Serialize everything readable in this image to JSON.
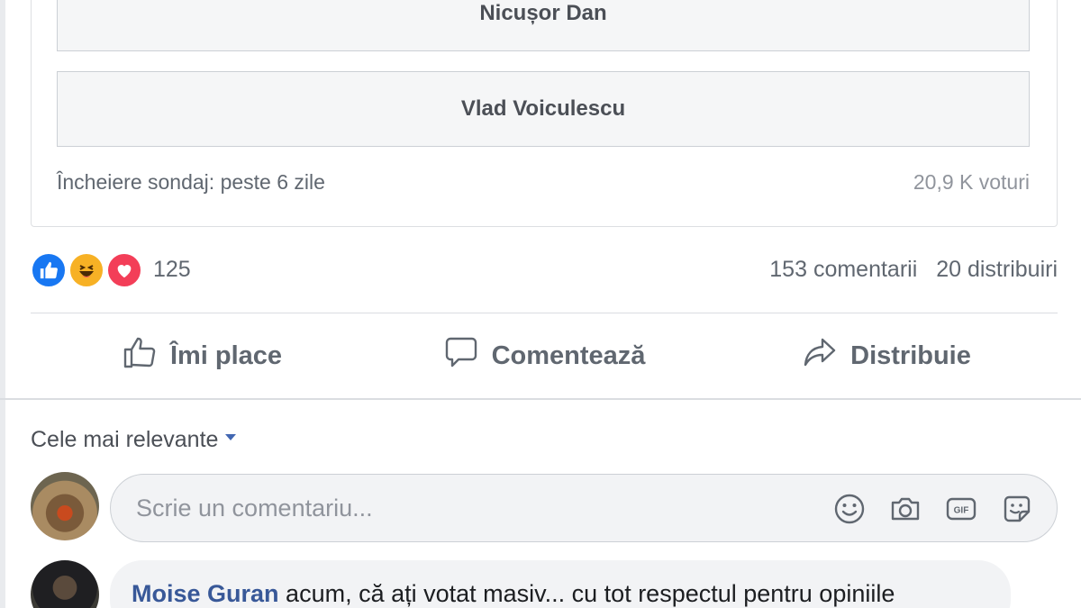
{
  "poll": {
    "options": [
      {
        "label": "Nicușor Dan"
      },
      {
        "label": "Vlad Voiculescu"
      }
    ],
    "closing_text": "Încheiere sondaj: peste 6 zile",
    "votes_text": "20,9 K voturi"
  },
  "reactions": {
    "icons": [
      "like-icon",
      "haha-icon",
      "love-icon"
    ],
    "count": "125",
    "comments_count": "153 comentarii",
    "shares_count": "20 distribuiri"
  },
  "actions": {
    "like_label": "Îmi place",
    "comment_label": "Comentează",
    "share_label": "Distribuie"
  },
  "comments": {
    "sort_label": "Cele mai relevante",
    "input_placeholder": "Scrie un comentariu...",
    "input_icons": [
      "emoji-icon",
      "camera-icon",
      "gif-icon",
      "sticker-icon"
    ],
    "items": [
      {
        "author": "Moise Guran",
        "text": "acum, că ați votat masiv... cu tot respectul pentru opiniile"
      }
    ]
  },
  "colors": {
    "link": "#385898",
    "like_blue": "#1877f2",
    "haha_yellow": "#f7b125",
    "love_red": "#f33e58",
    "muted_text": "#606770"
  }
}
